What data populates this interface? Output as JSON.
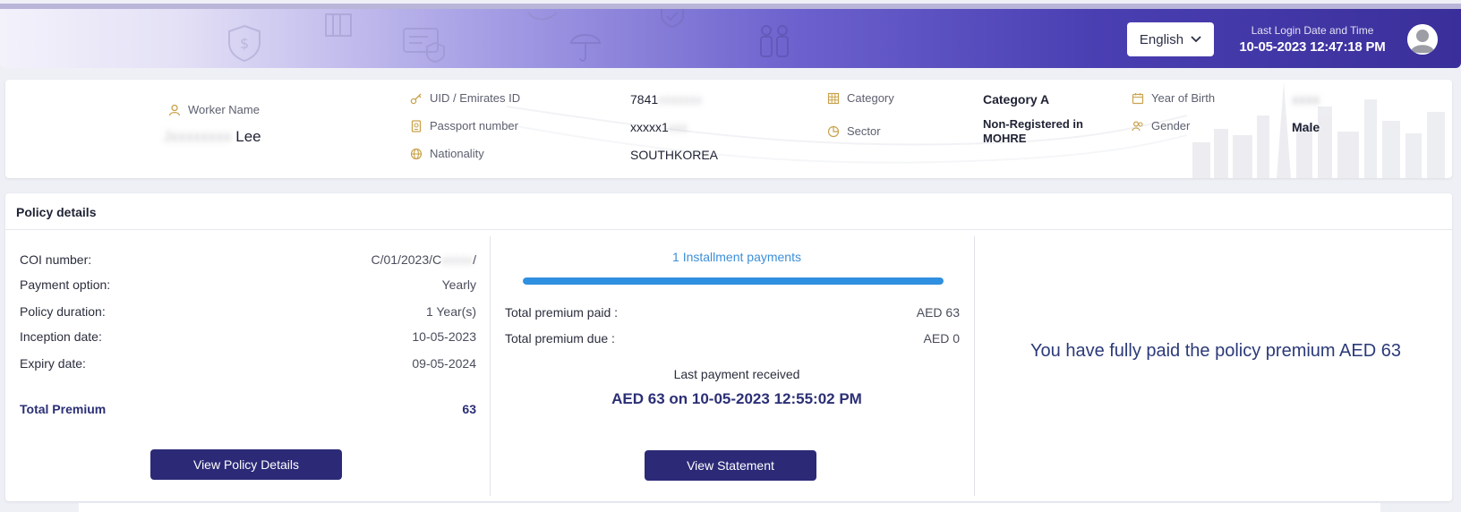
{
  "header": {
    "language": "English",
    "last_login_label": "Last Login Date and Time",
    "last_login_value": "10-05-2023 12:47:18 PM"
  },
  "worker": {
    "name_label": "Worker Name",
    "name_value": "Lee",
    "uid_label": "UID / Emirates ID",
    "uid_value": "7841",
    "passport_label": "Passport number",
    "passport_value": "xxxxx1",
    "nationality_label": "Nationality",
    "nationality_value": "SOUTHKOREA",
    "category_label": "Category",
    "category_value": "Category A",
    "sector_label": "Sector",
    "sector_value_line1": "Non-Registered in",
    "sector_value_line2": "MOHRE",
    "yob_label": "Year of Birth",
    "gender_label": "Gender",
    "gender_value": "Male"
  },
  "policy": {
    "title": "Policy details",
    "rows": [
      {
        "label": "COI number:",
        "value": "C/01/2023/C"
      },
      {
        "label": "Payment option:",
        "value": "Yearly"
      },
      {
        "label": "Policy duration:",
        "value": "1 Year(s)"
      },
      {
        "label": "Inception date:",
        "value": "10-05-2023"
      },
      {
        "label": "Expiry date:",
        "value": "09-05-2024"
      }
    ],
    "total_label": "Total Premium",
    "total_value": "63",
    "view_policy_button": "View Policy Details",
    "installments_label": "1 Installment payments",
    "installments_progress": 1.0,
    "premium_paid_label": "Total premium paid :",
    "premium_paid_value": "AED 63",
    "premium_due_label": "Total premium due :",
    "premium_due_value": "AED 0",
    "last_payment_label": "Last payment received",
    "last_payment_value": "AED 63 on 10-05-2023 12:55:02 PM",
    "view_statement_button": "View Statement",
    "paid_message": "You have fully paid the policy premium AED 63"
  },
  "colors": {
    "primary": "#2c2a77",
    "accent_blue": "#2f8fe0",
    "icon_gold": "#c9a24a"
  }
}
